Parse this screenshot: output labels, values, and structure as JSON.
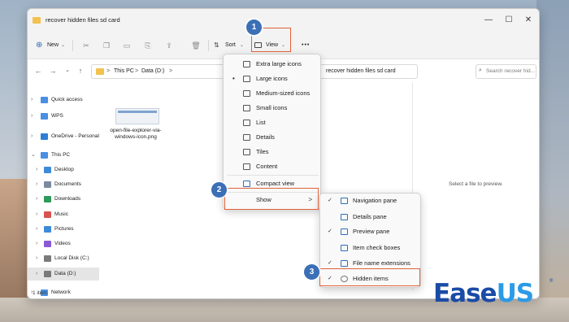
{
  "window": {
    "title": "recover hidden files sd card"
  },
  "window_controls": {
    "minimize": "—",
    "maximize": "☐",
    "close": "✕"
  },
  "toolbar": {
    "new_label": "New",
    "sort_label": "Sort",
    "view_label": "View",
    "more": "•••"
  },
  "address": {
    "segments": [
      "This PC",
      "Data (D:)",
      "recover hidden files sd card"
    ],
    "separator": ">",
    "search_placeholder": "Search recover hid..."
  },
  "sidebar": {
    "items": [
      {
        "label": "Quick access",
        "color": "#4a8fe0"
      },
      {
        "label": "WPS",
        "color": "#4a8fe0"
      },
      {
        "label": "OneDrive - Personal",
        "color": "#2d7fd6"
      },
      {
        "label": "This PC",
        "color": "#4a8fe0"
      },
      {
        "label": "Desktop",
        "color": "#3d8bd8"
      },
      {
        "label": "Documents",
        "color": "#7a8aa0"
      },
      {
        "label": "Downloads",
        "color": "#2d9a5a"
      },
      {
        "label": "Music",
        "color": "#d9534f"
      },
      {
        "label": "Pictures",
        "color": "#3d8bd8"
      },
      {
        "label": "Videos",
        "color": "#8a5ad6"
      },
      {
        "label": "Local Disk (C:)",
        "color": "#7a7a7a"
      },
      {
        "label": "Data (D:)",
        "color": "#7a7a7a"
      },
      {
        "label": "Network",
        "color": "#4a8fe0"
      }
    ]
  },
  "content": {
    "file_label": "open-file-explorer-via-windows-icon.png"
  },
  "preview": {
    "message": "Select a file to preview."
  },
  "status": {
    "count": "1 item"
  },
  "view_menu": {
    "items": [
      {
        "label": "Extra large icons",
        "bullet": ""
      },
      {
        "label": "Large icons",
        "bullet": "•"
      },
      {
        "label": "Medium-sized icons",
        "bullet": ""
      },
      {
        "label": "Small icons",
        "bullet": ""
      },
      {
        "label": "List",
        "bullet": ""
      },
      {
        "label": "Details",
        "bullet": ""
      },
      {
        "label": "Tiles",
        "bullet": ""
      },
      {
        "label": "Content",
        "bullet": ""
      },
      {
        "label": "Compact view",
        "bullet": ""
      },
      {
        "label": "Show",
        "bullet": ""
      }
    ],
    "submenu_arrow": ">"
  },
  "show_submenu": {
    "items": [
      {
        "label": "Navigation pane",
        "checked": "✓"
      },
      {
        "label": "Details pane",
        "checked": ""
      },
      {
        "label": "Preview pane",
        "checked": "✓"
      },
      {
        "label": "Item check boxes",
        "checked": ""
      },
      {
        "label": "File name extensions",
        "checked": "✓"
      },
      {
        "label": "Hidden items",
        "checked": "✓"
      }
    ]
  },
  "steps": [
    "1",
    "2",
    "3"
  ],
  "logo": {
    "part1": "Ease",
    "part2": "US",
    "mark": "®"
  },
  "colors": {
    "accent": "#e0613a",
    "step_badge": "#3b6fb6",
    "logo_dark": "#1a4ba6",
    "logo_light": "#2b9be6"
  }
}
